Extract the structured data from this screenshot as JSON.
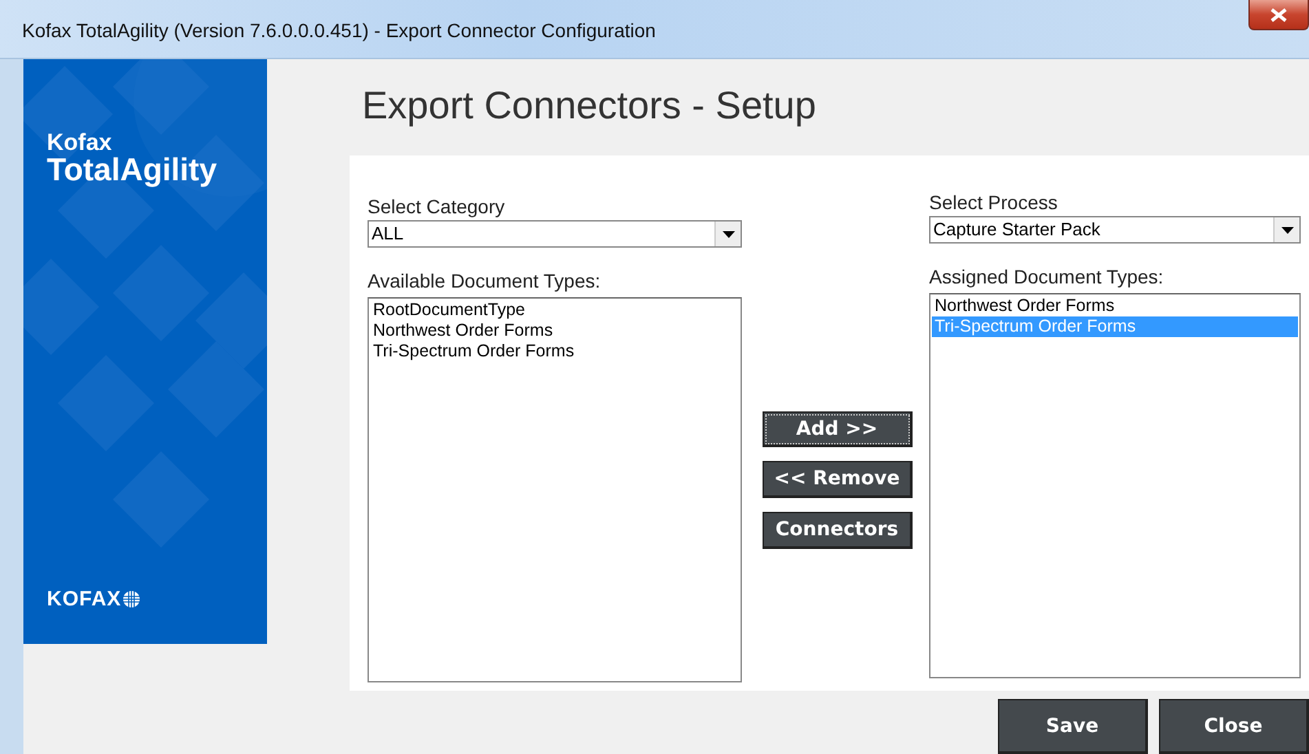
{
  "window": {
    "title": "Kofax TotalAgility (Version 7.6.0.0.0.451) - Export Connector Configuration"
  },
  "sidebar": {
    "brand_line_1": "Kofax",
    "brand_line_2": "TotalAgility",
    "footer_logo": "KOFAX"
  },
  "header": {
    "title": "Export Connectors - Setup"
  },
  "left": {
    "category_label": "Select Category",
    "category": {
      "value": "ALL"
    },
    "list_label": "Available Document Types:",
    "items": [
      {
        "label": "RootDocumentType",
        "selected": false
      },
      {
        "label": "Northwest Order Forms",
        "selected": false
      },
      {
        "label": "Tri-Spectrum Order Forms",
        "selected": false
      }
    ]
  },
  "middle_buttons": [
    {
      "label": "Add >>",
      "focused": true
    },
    {
      "label": "<< Remove",
      "focused": false
    },
    {
      "label": "Connectors",
      "focused": false
    }
  ],
  "right": {
    "process_label": "Select Process",
    "process": {
      "value": "Capture Starter Pack"
    },
    "list_label": "Assigned Document Types:",
    "items": [
      {
        "label": "Northwest Order Forms",
        "selected": false
      },
      {
        "label": "Tri-Spectrum Order Forms",
        "selected": true
      }
    ]
  },
  "footer_buttons": [
    {
      "label": "Save"
    },
    {
      "label": "Close"
    }
  ]
}
